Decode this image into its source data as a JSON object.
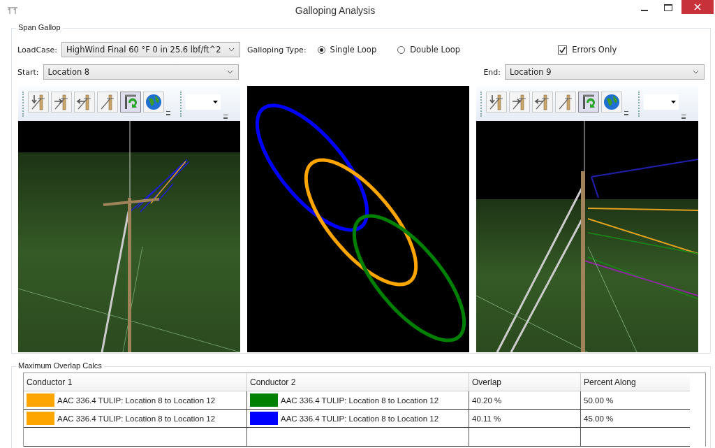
{
  "window": {
    "title": "Galloping Analysis"
  },
  "span_gallop": {
    "title": "Span Gallop",
    "loadcase": {
      "label": "LoadCase:",
      "value": "HighWind Final 60 °F 0 in 25.6 lbf/ft^2"
    },
    "galloping_type": {
      "label": "Galloping Type:",
      "options": [
        {
          "label": "Single Loop",
          "selected": true
        },
        {
          "label": "Double Loop",
          "selected": false
        }
      ]
    },
    "errors_only": {
      "label": "Errors Only",
      "checked": true
    },
    "start": {
      "label": "Start:",
      "value": "Location 8"
    },
    "end": {
      "label": "End:",
      "value": "Location 9"
    },
    "gallop_view": {
      "loops": [
        {
          "color": "#0000ff"
        },
        {
          "color": "#ffa500"
        },
        {
          "color": "#008000"
        }
      ]
    }
  },
  "overlap": {
    "title": "Maximum Overlap Calcs",
    "columns": [
      "Conductor 1",
      "Conductor 2",
      "Overlap",
      "Percent Along"
    ],
    "rows": [
      {
        "conductor_1": {
          "color": "#ffa500",
          "name": "AAC 336.4 TULIP: Location 8 to Location 12"
        },
        "conductor_2": {
          "color": "#008000",
          "name": "AAC 336.4 TULIP: Location 8 to Location 12"
        },
        "overlap": "40.20 %",
        "percent_along": "50.00 %"
      },
      {
        "conductor_1": {
          "color": "#ffa500",
          "name": "AAC 336.4 TULIP: Location 8 to Location 12"
        },
        "conductor_2": {
          "color": "#0000ff",
          "name": "AAC 336.4 TULIP: Location 8 to Location 12"
        },
        "overlap": "40.11 %",
        "percent_along": "45.00 %"
      }
    ]
  }
}
